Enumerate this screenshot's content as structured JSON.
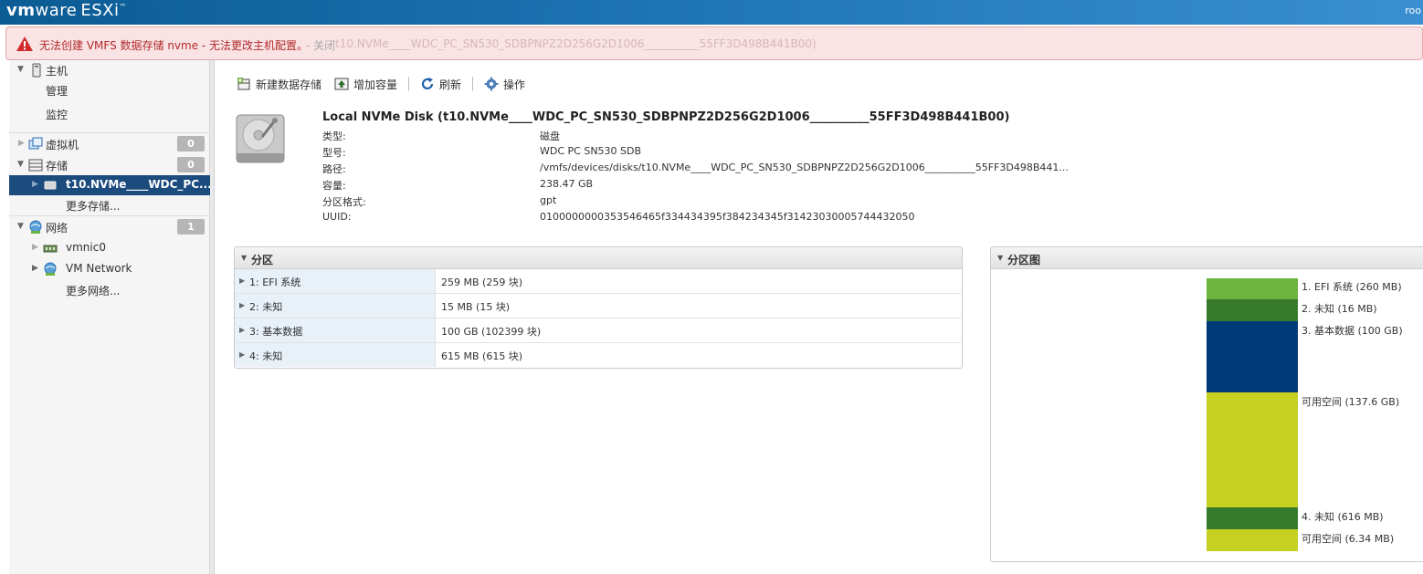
{
  "header": {
    "logo_vm": "vm",
    "logo_ware": "ware",
    "product": "ESXi",
    "user": "roo"
  },
  "alert": {
    "message": "无法创建 VMFS 数据存储 nvme - 无法更改主机配置。",
    "close_label": "- 关闭",
    "ghost_text": "t10.NVMe____WDC_PC_SN530_SDBPNPZ2D256G2D1006__________55FF3D498B441B00)"
  },
  "sidebar": {
    "host": "主机",
    "manage": "管理",
    "monitor": "监控",
    "vms": "虚拟机",
    "vms_count": "0",
    "storage": "存储",
    "storage_count": "0",
    "selected_device": "t10.NVMe____WDC_PC...",
    "more_storage": "更多存储...",
    "network": "网络",
    "network_count": "1",
    "vmnic": "vmnic0",
    "vm_network": "VM Network",
    "more_network": "更多网络..."
  },
  "toolbar": {
    "new_datastore": "新建数据存储",
    "increase_capacity": "增加容量",
    "refresh": "刷新",
    "actions": "操作"
  },
  "disk": {
    "title": "Local NVMe Disk (t10.NVMe____WDC_PC_SN530_SDBPNPZ2D256G2D1006__________55FF3D498B441B00)",
    "props": [
      {
        "key": "类型:",
        "value": "磁盘"
      },
      {
        "key": "型号:",
        "value": "WDC PC SN530 SDB"
      },
      {
        "key": "路径:",
        "value": "/vmfs/devices/disks/t10.NVMe____WDC_PC_SN530_SDBPNPZ2D256G2D1006__________55FF3D498B441..."
      },
      {
        "key": "容量:",
        "value": "238.47 GB"
      },
      {
        "key": "分区格式:",
        "value": "gpt"
      },
      {
        "key": "UUID:",
        "value": "0100000000353546465f334434395f384234345f31423030005744432050"
      }
    ]
  },
  "partitions": {
    "title": "分区",
    "rows": [
      {
        "name": "1: EFI 系统",
        "size": "259 MB (259 块)"
      },
      {
        "name": "2: 未知",
        "size": "15 MB (15 块)"
      },
      {
        "name": "3: 基本数据",
        "size": "100 GB (102399 块)"
      },
      {
        "name": "4: 未知",
        "size": "615 MB (615 块)"
      }
    ]
  },
  "partition_map": {
    "title": "分区图",
    "segments": [
      {
        "label": "1. EFI 系统   (260 MB)",
        "color": "#6db33f"
      },
      {
        "label": "2. 未知   (16 MB)",
        "color": "#367a2c"
      },
      {
        "label": "3. 基本数据   (100 GB)",
        "color": "#003a78"
      },
      {
        "label": "可用空间   (137.6 GB)",
        "color": "#c5d021"
      },
      {
        "label": "4. 未知   (616 MB)",
        "color": "#367a2c"
      },
      {
        "label": "可用空间   (6.34 MB)",
        "color": "#c5d021"
      }
    ]
  },
  "colors": {
    "header_start": "#0b5b94",
    "header_end": "#3a8fd0",
    "alert_bg": "#f9e3e4",
    "alert_text": "#b22b2b",
    "selected_nav": "#1c4b7d"
  }
}
